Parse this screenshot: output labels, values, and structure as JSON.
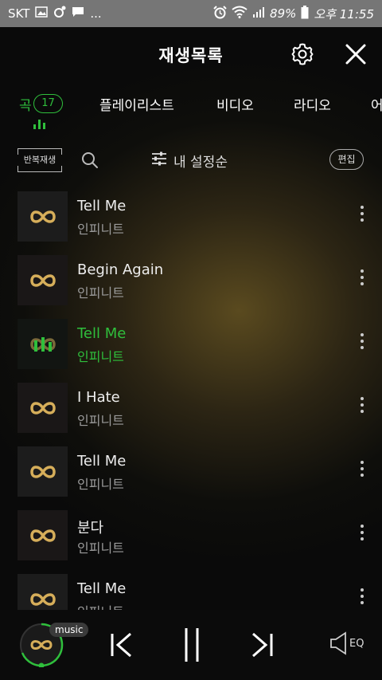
{
  "status_bar": {
    "carrier": "SKT",
    "dots": "...",
    "battery": "89%",
    "time": "오후 11:55"
  },
  "header": {
    "title": "재생목록",
    "settings_icon": "gear-icon",
    "close_icon": "close-icon"
  },
  "tabs": [
    {
      "label": "곡",
      "count": "17",
      "active": true
    },
    {
      "label": "플레이리스트",
      "active": false
    },
    {
      "label": "비디오",
      "active": false
    },
    {
      "label": "라디오",
      "active": false
    },
    {
      "label": "어",
      "active": false
    }
  ],
  "toolbar": {
    "repeat_label": "반복재생",
    "sort_label": "내 설정순",
    "edit_label": "편집"
  },
  "songs": [
    {
      "title": "Tell Me",
      "artist": "인피니트",
      "playing": false
    },
    {
      "title": "Begin Again",
      "artist": "인피니트",
      "playing": false
    },
    {
      "title": "Tell Me",
      "artist": "인피니트",
      "playing": true
    },
    {
      "title": "I Hate",
      "artist": "인피니트",
      "playing": false
    },
    {
      "title": "Tell Me",
      "artist": "인피니트",
      "playing": false
    },
    {
      "title": "분다",
      "artist": "인피니트",
      "playing": false
    },
    {
      "title": "Tell Me",
      "artist": "인피니트",
      "playing": false
    }
  ],
  "player": {
    "app_label": "music",
    "eq_label": "EQ"
  },
  "colors": {
    "accent": "#2fbf3c",
    "logo_gold": "#d6ae5a"
  }
}
